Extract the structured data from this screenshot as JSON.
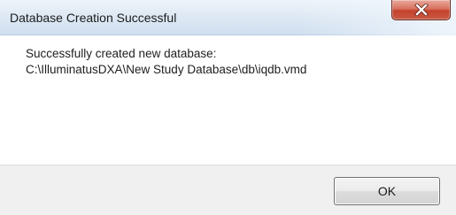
{
  "window": {
    "title": "Database Creation Successful"
  },
  "message": {
    "line1": "Successfully created new database:",
    "line2": "C:\\IlluminatusDXA\\New Study Database\\db\\iqdb.vmd"
  },
  "buttons": {
    "ok_label": "OK"
  },
  "icons": {
    "close": "close-icon"
  },
  "colors": {
    "close_button": "#c4422c",
    "titlebar": "#dfe9f4",
    "footer": "#f0f0f0"
  }
}
